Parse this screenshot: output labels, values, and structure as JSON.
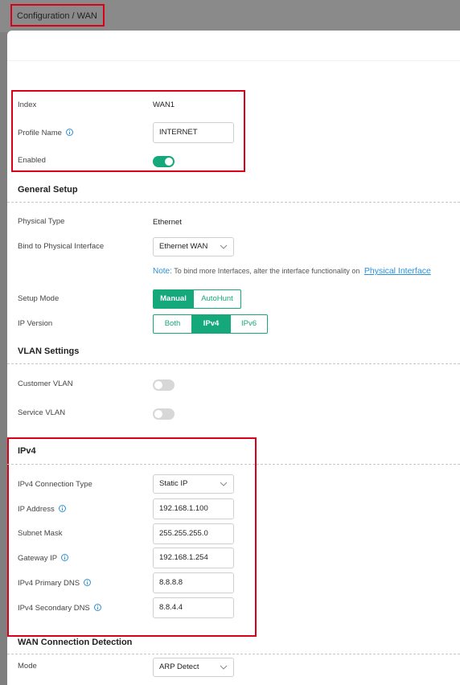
{
  "breadcrumb": "Configuration / WAN",
  "profile": {
    "index_label": "Index",
    "index_value": "WAN1",
    "name_label": "Profile Name",
    "name_value": "INTERNET",
    "enabled_label": "Enabled",
    "enabled": true
  },
  "general": {
    "title": "General Setup",
    "physical_type_label": "Physical Type",
    "physical_type_value": "Ethernet",
    "bind_label": "Bind to Physical Interface",
    "bind_value": "Ethernet WAN",
    "note_label": "Note:",
    "note_text": "To bind more Interfaces, alter the interface functionality on",
    "note_link": "Physical Interface",
    "setup_mode_label": "Setup Mode",
    "setup_mode_options": [
      "Manual",
      "AutoHunt"
    ],
    "setup_mode_selected": "Manual",
    "ip_version_label": "IP Version",
    "ip_version_options": [
      "Both",
      "IPv4",
      "IPv6"
    ],
    "ip_version_selected": "IPv4"
  },
  "vlan": {
    "title": "VLAN Settings",
    "customer_label": "Customer VLAN",
    "customer_enabled": false,
    "service_label": "Service VLAN",
    "service_enabled": false
  },
  "ipv4": {
    "title": "IPv4",
    "conn_type_label": "IPv4 Connection Type",
    "conn_type_value": "Static IP",
    "ip_label": "IP Address",
    "ip_value": "192.168.1.100",
    "mask_label": "Subnet Mask",
    "mask_value": "255.255.255.0",
    "gateway_label": "Gateway IP",
    "gateway_value": "192.168.1.254",
    "dns1_label": "IPv4 Primary DNS",
    "dns1_value": "8.8.8.8",
    "dns2_label": "IPv4 Secondary DNS",
    "dns2_value": "8.8.4.4"
  },
  "detection": {
    "title": "WAN Connection Detection",
    "mode_label": "Mode",
    "mode_value": "ARP Detect"
  },
  "colors": {
    "accent": "#14a87a",
    "link": "#2a91d8",
    "highlight": "#d9001b"
  }
}
